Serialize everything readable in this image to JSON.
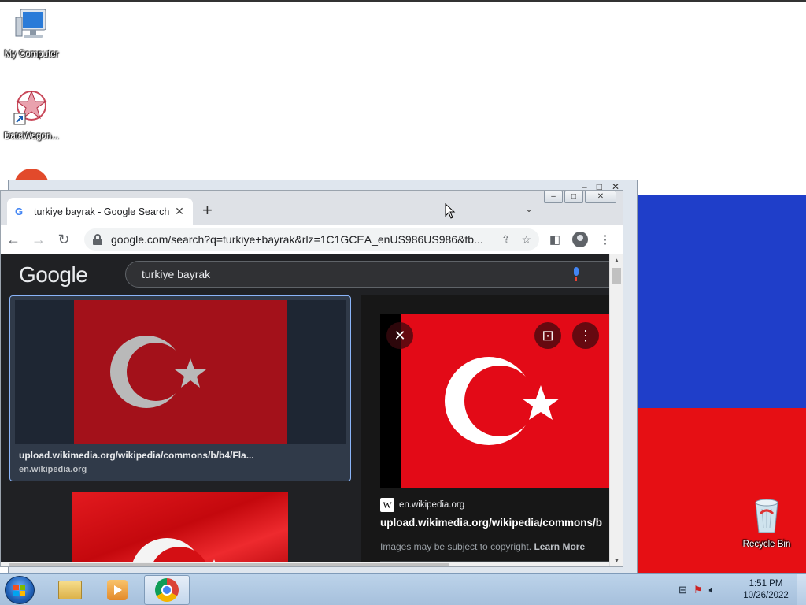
{
  "desktop": {
    "icons": [
      {
        "label": "My Computer",
        "icon": "computer-icon"
      },
      {
        "label": "DataWagon...",
        "icon": "datawagon-icon"
      },
      {
        "label": "Recycle Bin",
        "icon": "recycle-bin-icon"
      }
    ],
    "wallpaper_colors": {
      "blue": "#1f3ec9",
      "red": "#e60f14"
    }
  },
  "browser": {
    "tab": {
      "title": "turkiye bayrak - Google Search",
      "favicon": "google-g-icon"
    },
    "address_bar": {
      "url": "google.com/search?q=turkiye+bayrak&rlz=1C1GCEA_enUS986US986&tb..."
    },
    "page": {
      "logo": "Google",
      "search_query": "turkiye bayrak",
      "selected_result": {
        "url": "upload.wikimedia.org/wikipedia/commons/b/b4/Fla...",
        "site": "en.wikipedia.org"
      },
      "preview": {
        "source_badge": "W",
        "source": "en.wikipedia.org",
        "title": "upload.wikimedia.org/wikipedia/commons/b",
        "copyright_text": "Images may be subject to copyright.",
        "learn_more": "Learn More",
        "close_glyph": "✕",
        "more_glyph": "⋮"
      }
    }
  },
  "taskbar": {
    "clock_time": "1:51 PM",
    "clock_date": "10/26/2022",
    "items": [
      "windows-explorer",
      "media-player",
      "google-chrome"
    ]
  }
}
